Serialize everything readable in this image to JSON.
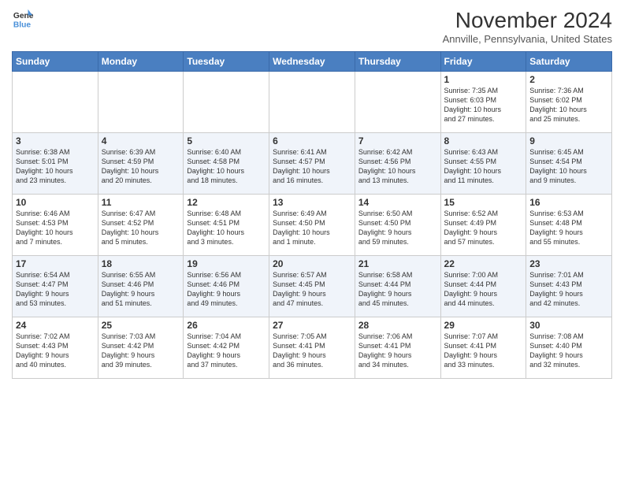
{
  "logo": {
    "line1": "General",
    "line2": "Blue"
  },
  "title": "November 2024",
  "location": "Annville, Pennsylvania, United States",
  "days_header": [
    "Sunday",
    "Monday",
    "Tuesday",
    "Wednesday",
    "Thursday",
    "Friday",
    "Saturday"
  ],
  "weeks": [
    [
      {
        "day": "",
        "info": ""
      },
      {
        "day": "",
        "info": ""
      },
      {
        "day": "",
        "info": ""
      },
      {
        "day": "",
        "info": ""
      },
      {
        "day": "",
        "info": ""
      },
      {
        "day": "1",
        "info": "Sunrise: 7:35 AM\nSunset: 6:03 PM\nDaylight: 10 hours\nand 27 minutes."
      },
      {
        "day": "2",
        "info": "Sunrise: 7:36 AM\nSunset: 6:02 PM\nDaylight: 10 hours\nand 25 minutes."
      }
    ],
    [
      {
        "day": "3",
        "info": "Sunrise: 6:38 AM\nSunset: 5:01 PM\nDaylight: 10 hours\nand 23 minutes."
      },
      {
        "day": "4",
        "info": "Sunrise: 6:39 AM\nSunset: 4:59 PM\nDaylight: 10 hours\nand 20 minutes."
      },
      {
        "day": "5",
        "info": "Sunrise: 6:40 AM\nSunset: 4:58 PM\nDaylight: 10 hours\nand 18 minutes."
      },
      {
        "day": "6",
        "info": "Sunrise: 6:41 AM\nSunset: 4:57 PM\nDaylight: 10 hours\nand 16 minutes."
      },
      {
        "day": "7",
        "info": "Sunrise: 6:42 AM\nSunset: 4:56 PM\nDaylight: 10 hours\nand 13 minutes."
      },
      {
        "day": "8",
        "info": "Sunrise: 6:43 AM\nSunset: 4:55 PM\nDaylight: 10 hours\nand 11 minutes."
      },
      {
        "day": "9",
        "info": "Sunrise: 6:45 AM\nSunset: 4:54 PM\nDaylight: 10 hours\nand 9 minutes."
      }
    ],
    [
      {
        "day": "10",
        "info": "Sunrise: 6:46 AM\nSunset: 4:53 PM\nDaylight: 10 hours\nand 7 minutes."
      },
      {
        "day": "11",
        "info": "Sunrise: 6:47 AM\nSunset: 4:52 PM\nDaylight: 10 hours\nand 5 minutes."
      },
      {
        "day": "12",
        "info": "Sunrise: 6:48 AM\nSunset: 4:51 PM\nDaylight: 10 hours\nand 3 minutes."
      },
      {
        "day": "13",
        "info": "Sunrise: 6:49 AM\nSunset: 4:50 PM\nDaylight: 10 hours\nand 1 minute."
      },
      {
        "day": "14",
        "info": "Sunrise: 6:50 AM\nSunset: 4:50 PM\nDaylight: 9 hours\nand 59 minutes."
      },
      {
        "day": "15",
        "info": "Sunrise: 6:52 AM\nSunset: 4:49 PM\nDaylight: 9 hours\nand 57 minutes."
      },
      {
        "day": "16",
        "info": "Sunrise: 6:53 AM\nSunset: 4:48 PM\nDaylight: 9 hours\nand 55 minutes."
      }
    ],
    [
      {
        "day": "17",
        "info": "Sunrise: 6:54 AM\nSunset: 4:47 PM\nDaylight: 9 hours\nand 53 minutes."
      },
      {
        "day": "18",
        "info": "Sunrise: 6:55 AM\nSunset: 4:46 PM\nDaylight: 9 hours\nand 51 minutes."
      },
      {
        "day": "19",
        "info": "Sunrise: 6:56 AM\nSunset: 4:46 PM\nDaylight: 9 hours\nand 49 minutes."
      },
      {
        "day": "20",
        "info": "Sunrise: 6:57 AM\nSunset: 4:45 PM\nDaylight: 9 hours\nand 47 minutes."
      },
      {
        "day": "21",
        "info": "Sunrise: 6:58 AM\nSunset: 4:44 PM\nDaylight: 9 hours\nand 45 minutes."
      },
      {
        "day": "22",
        "info": "Sunrise: 7:00 AM\nSunset: 4:44 PM\nDaylight: 9 hours\nand 44 minutes."
      },
      {
        "day": "23",
        "info": "Sunrise: 7:01 AM\nSunset: 4:43 PM\nDaylight: 9 hours\nand 42 minutes."
      }
    ],
    [
      {
        "day": "24",
        "info": "Sunrise: 7:02 AM\nSunset: 4:43 PM\nDaylight: 9 hours\nand 40 minutes."
      },
      {
        "day": "25",
        "info": "Sunrise: 7:03 AM\nSunset: 4:42 PM\nDaylight: 9 hours\nand 39 minutes."
      },
      {
        "day": "26",
        "info": "Sunrise: 7:04 AM\nSunset: 4:42 PM\nDaylight: 9 hours\nand 37 minutes."
      },
      {
        "day": "27",
        "info": "Sunrise: 7:05 AM\nSunset: 4:41 PM\nDaylight: 9 hours\nand 36 minutes."
      },
      {
        "day": "28",
        "info": "Sunrise: 7:06 AM\nSunset: 4:41 PM\nDaylight: 9 hours\nand 34 minutes."
      },
      {
        "day": "29",
        "info": "Sunrise: 7:07 AM\nSunset: 4:41 PM\nDaylight: 9 hours\nand 33 minutes."
      },
      {
        "day": "30",
        "info": "Sunrise: 7:08 AM\nSunset: 4:40 PM\nDaylight: 9 hours\nand 32 minutes."
      }
    ]
  ]
}
